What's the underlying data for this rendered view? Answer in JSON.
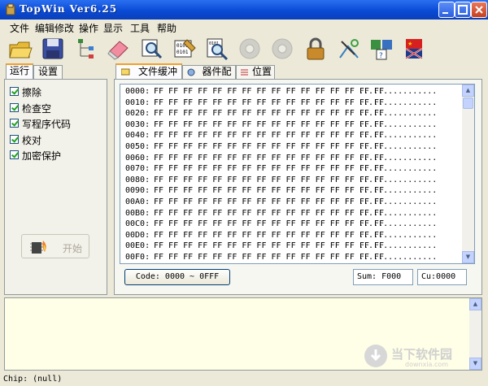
{
  "window": {
    "title": "TopWin Ver6.25"
  },
  "menu": [
    "文件",
    "编辑修改",
    "操作",
    "显示",
    "工具",
    "帮助"
  ],
  "toolbar": [
    "open-folder-icon",
    "save-disk-icon",
    "tree-icon",
    "eraser-icon",
    "search-chip-icon",
    "binary-file-icon",
    "search-binary-icon",
    "disc-icon",
    "disc-icon",
    "lock-icon",
    "antenna-icon",
    "chip-help-icon",
    "flag-icon"
  ],
  "left_tabs": [
    "运行",
    "设置"
  ],
  "options": [
    "擦除",
    "检查空",
    "写程序代码",
    "校对",
    "加密保护"
  ],
  "start_button": {
    "label": "开始"
  },
  "right_tabs": [
    "文件缓冲区",
    "器件配置",
    "位置"
  ],
  "hex": {
    "rows": [
      {
        "addr": "0000:",
        "bytes": "FF FF FF FF FF FF FF FF FF FF FF FF FF FF FF FF",
        "ascii": "................"
      },
      {
        "addr": "0010:",
        "bytes": "FF FF FF FF FF FF FF FF FF FF FF FF FF FF FF FF",
        "ascii": "................"
      },
      {
        "addr": "0020:",
        "bytes": "FF FF FF FF FF FF FF FF FF FF FF FF FF FF FF FF",
        "ascii": "................"
      },
      {
        "addr": "0030:",
        "bytes": "FF FF FF FF FF FF FF FF FF FF FF FF FF FF FF FF",
        "ascii": "................"
      },
      {
        "addr": "0040:",
        "bytes": "FF FF FF FF FF FF FF FF FF FF FF FF FF FF FF FF",
        "ascii": "................"
      },
      {
        "addr": "0050:",
        "bytes": "FF FF FF FF FF FF FF FF FF FF FF FF FF FF FF FF",
        "ascii": "................"
      },
      {
        "addr": "0060:",
        "bytes": "FF FF FF FF FF FF FF FF FF FF FF FF FF FF FF FF",
        "ascii": "................"
      },
      {
        "addr": "0070:",
        "bytes": "FF FF FF FF FF FF FF FF FF FF FF FF FF FF FF FF",
        "ascii": "................"
      },
      {
        "addr": "0080:",
        "bytes": "FF FF FF FF FF FF FF FF FF FF FF FF FF FF FF FF",
        "ascii": "................"
      },
      {
        "addr": "0090:",
        "bytes": "FF FF FF FF FF FF FF FF FF FF FF FF FF FF FF FF",
        "ascii": "................"
      },
      {
        "addr": "00A0:",
        "bytes": "FF FF FF FF FF FF FF FF FF FF FF FF FF FF FF FF",
        "ascii": "................"
      },
      {
        "addr": "00B0:",
        "bytes": "FF FF FF FF FF FF FF FF FF FF FF FF FF FF FF FF",
        "ascii": "................"
      },
      {
        "addr": "00C0:",
        "bytes": "FF FF FF FF FF FF FF FF FF FF FF FF FF FF FF FF",
        "ascii": "................"
      },
      {
        "addr": "00D0:",
        "bytes": "FF FF FF FF FF FF FF FF FF FF FF FF FF FF FF FF",
        "ascii": "................"
      },
      {
        "addr": "00E0:",
        "bytes": "FF FF FF FF FF FF FF FF FF FF FF FF FF FF FF FF",
        "ascii": "................"
      },
      {
        "addr": "00F0:",
        "bytes": "FF FF FF FF FF FF FF FF FF FF FF FF FF FF FF FF",
        "ascii": "................"
      }
    ]
  },
  "code_range": "Code: 0000 ~ 0FFF",
  "sum": "Sum:  F000",
  "cu": "Cu:0000",
  "status": "Chip:  (null)",
  "watermark": {
    "big": "当下软件园",
    "small": "downxia.com"
  }
}
